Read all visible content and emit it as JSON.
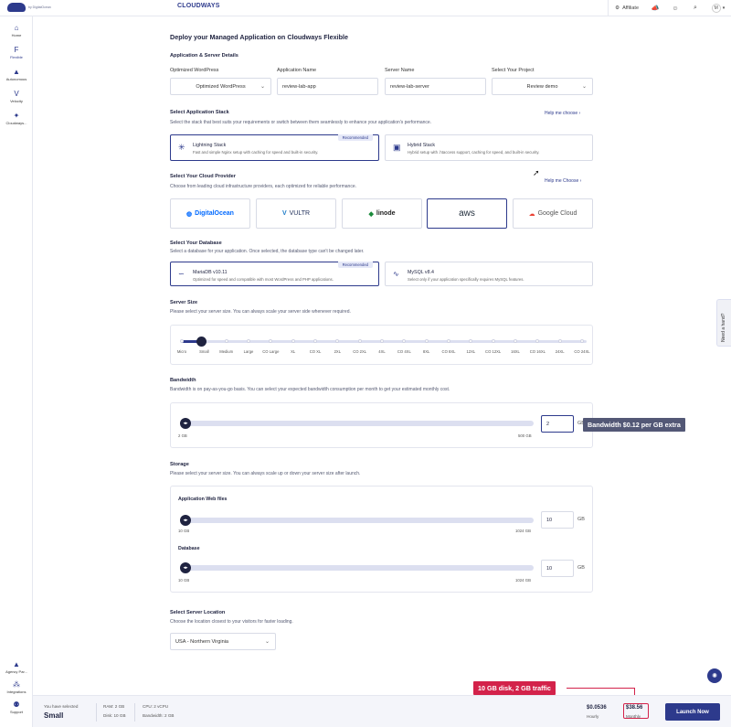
{
  "topbar": {
    "brand": "CLOUDWAYS",
    "brand_sub": "by DigitalOcean",
    "affiliate": "Affiliate",
    "avatar": "M"
  },
  "sidebar": {
    "items": [
      {
        "label": "Home",
        "icon": "home-icon"
      },
      {
        "label": "Flexible",
        "icon": "flexible-icon"
      },
      {
        "label": "Autonomous",
        "icon": "autonomous-icon"
      },
      {
        "label": "Velocity",
        "icon": "velocity-icon"
      },
      {
        "label": "Cloudways...",
        "icon": "sparkle-icon"
      },
      {
        "label": "Agency Par...",
        "icon": "agency-icon"
      },
      {
        "label": "Integrations",
        "icon": "integrations-icon"
      },
      {
        "label": "Support",
        "icon": "support-icon"
      }
    ]
  },
  "page": {
    "title": "Deploy your Managed Application on Cloudways Flexible",
    "details_title": "Application & Server Details",
    "fields": {
      "app_label": "Optimized WordPress",
      "app_value": "Optimized WordPress",
      "name_label": "Application Name",
      "name_value": "review-lab-app",
      "server_label": "Server Name",
      "server_value": "review-lab-server",
      "project_label": "Select Your Project",
      "project_value": "Review demo"
    },
    "stack": {
      "title": "Select Application Stack",
      "desc": "Select the stack that best suits your requirements or switch between them seamlessly to enhance your application's performance.",
      "help": "Help me choose",
      "cards": [
        {
          "title": "Lightning Stack",
          "desc": "Fast and simple Nginx setup with caching for speed and built-in security.",
          "badge": "Recommended"
        },
        {
          "title": "Hybrid Stack",
          "desc": "Hybrid setup with .htaccess support, caching for speed, and built-in security."
        }
      ]
    },
    "provider": {
      "title": "Select Your Cloud Provider",
      "desc": "Choose from leading cloud infrastructure providers, each optimized for reliable performance.",
      "help": "Help me Choose",
      "items": [
        "DigitalOcean",
        "VULTR",
        "linode",
        "aws",
        "Google Cloud"
      ]
    },
    "database": {
      "title": "Select Your Database",
      "desc": "Select a database for your application. Once selected, the database type can't be changed later.",
      "cards": [
        {
          "title": "MariaDB v10.11",
          "desc": "Optimized for speed and compatible with most WordPress and PHP applications.",
          "badge": "Recommended"
        },
        {
          "title": "MySQL v8.4",
          "desc": "Select only if your application specifically requires MySQL features."
        }
      ]
    },
    "server_size": {
      "title": "Server Size",
      "desc": "Please select your server size. You can always scale your server side whenever required.",
      "labels": [
        "Micro",
        "Small",
        "Medium",
        "Large",
        "CO Large",
        "XL",
        "CO XL",
        "2XL",
        "CO 2XL",
        "4XL",
        "CO 4XL",
        "8XL",
        "CO 8XL",
        "12XL",
        "CO 12XL",
        "16XL",
        "CO 16XL",
        "24XL",
        "CO 24XL"
      ],
      "selected": "Small"
    },
    "bandwidth": {
      "title": "Bandwidth",
      "desc": "Bandwidth is on pay-as-you-go basis. You can select your expected bandwidth consumption per month to get your estimated monthly cost.",
      "min": "2 GB",
      "max": "500 GB",
      "value": "2",
      "unit": "GB",
      "tooltip": "Bandwidth $0.12 per GB extra"
    },
    "storage": {
      "title": "Storage",
      "desc": "Please select your server size. You can always scale up or down your server size after launch.",
      "web_title": "Application Web files",
      "web_min": "10 GB",
      "web_max": "1024 GB",
      "web_value": "10",
      "db_title": "Database",
      "db_min": "10 GB",
      "db_max": "1024 GB",
      "db_value": "10",
      "unit": "GB"
    },
    "location": {
      "title": "Select Server Location",
      "desc": "Choose the location closest to your visitors for faster loading.",
      "value": "USA - Northern Virginia"
    }
  },
  "need_hand": "Need a hand?",
  "annotation": "10 GB disk, 2 GB traffic",
  "footer": {
    "selected_label": "You have selected",
    "selected_value": "Small",
    "ram": "RAM: 2 GB",
    "disk": "Disk: 10 GB",
    "cpu": "CPU: 2 vCPU",
    "bandwidth": "Bandwidth: 2 GB",
    "hourly_price": "$0.0536",
    "hourly_label": "Hourly",
    "monthly_price": "$38.56",
    "monthly_label": "Monthly",
    "launch": "Launch Now"
  },
  "colors": {
    "accent": "#2d3a8c",
    "highlight": "#d3224a",
    "tooltip": "#535876"
  }
}
